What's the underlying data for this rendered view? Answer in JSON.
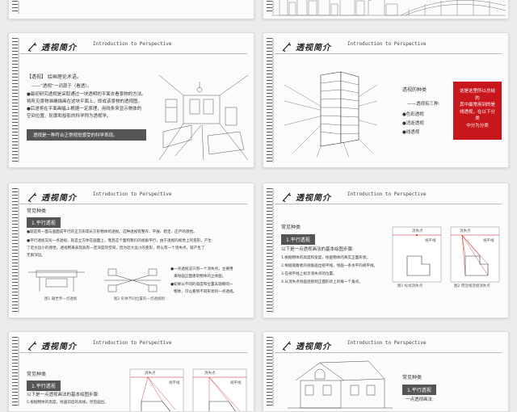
{
  "brand": "透视简介",
  "subtitle": "Introduction to Perspective",
  "s2": {
    "heading": "【透视】 绘画理论术语。",
    "lines": [
      "——“透视”一词源于（看透）。",
      "●最初研究透视是采取通过一块透明的平面去看景物的方法。",
      "将所见景物准确描画在这块平面上，即成该景物的透视图。",
      "●后遂将在平面画幅上根据一定原理，用线条来显示物体的",
      "空间位置、轮廓和投影的科学称为透视学。"
    ],
    "banner": "透视是一种符合正常视觉感受的科学表现。"
  },
  "s3": {
    "title": "透视的种类",
    "intro": "——透视有三种:",
    "items": [
      "●色彩透视",
      "●消逝透视",
      "●线透视"
    ],
    "redbox": [
      "这是这里所以总结的",
      "其中最常用到的是",
      "线透视，在以下分类",
      "中分为分类"
    ]
  },
  "s4": {
    "title": "常见种类",
    "tag": "1.平行透视",
    "lines": [
      "●就是有一面与画面成平行的正方形或长方形物体的透视。这种透视有整齐、平展、稳定、庄严的感觉。",
      "●平行透视又叫一点透视，就是立方体在画面上，而且这个面和我们的视角平行，由于透视的视觉上的变形，产生",
      "了近大远小的感觉。透视用来表现具有一定深度的空间，因为近大远小的变形，所以有一个消失点，就产生了",
      "无限深远。"
    ],
    "bullets": [
      "●一点透视法只有一个消失点，主要用",
      "来绘画正面建筑物体的立体图。",
      "●如果从不同的高度和位置去观察同一",
      "物体，可以看到不同形状的一点透视。"
    ],
    "cap1": "图1 箱世界一点透视",
    "cap2": "图2 形体不同位置的一点透视图"
  },
  "s5": {
    "title": "常见种类",
    "tag": "1.平行透视",
    "intro": "以下是一点透视画法的基本绘图步骤:",
    "steps": [
      "1.根据物体的高度和宽度，绘画物体的真实正面形状。",
      "2.根据观察者的视角画出视平线，绘画一条水平的视平线。",
      "3.在视平线上标示消失点的位置。",
      "4.从消失点绘画连接到正面形状上的每一个角点。"
    ],
    "label_vp": "消失点",
    "label_hl": "视平线",
    "cap1": "图1  标式消失点",
    "cap2": "图2  用连线连接消失点"
  },
  "s6": {
    "title": "常见种类",
    "tag": "1.平行透视",
    "intro": "以下是一点透视画法的基本绘图步骤:",
    "steps": [
      "5.根据物体的高度，绘画前后的高线，然后画出。"
    ],
    "label_vp": "消失点",
    "label_hl": "视平线"
  },
  "s7": {
    "title": "常见种类",
    "tag": "1.平行透视",
    "sub": "一点透视画法"
  }
}
